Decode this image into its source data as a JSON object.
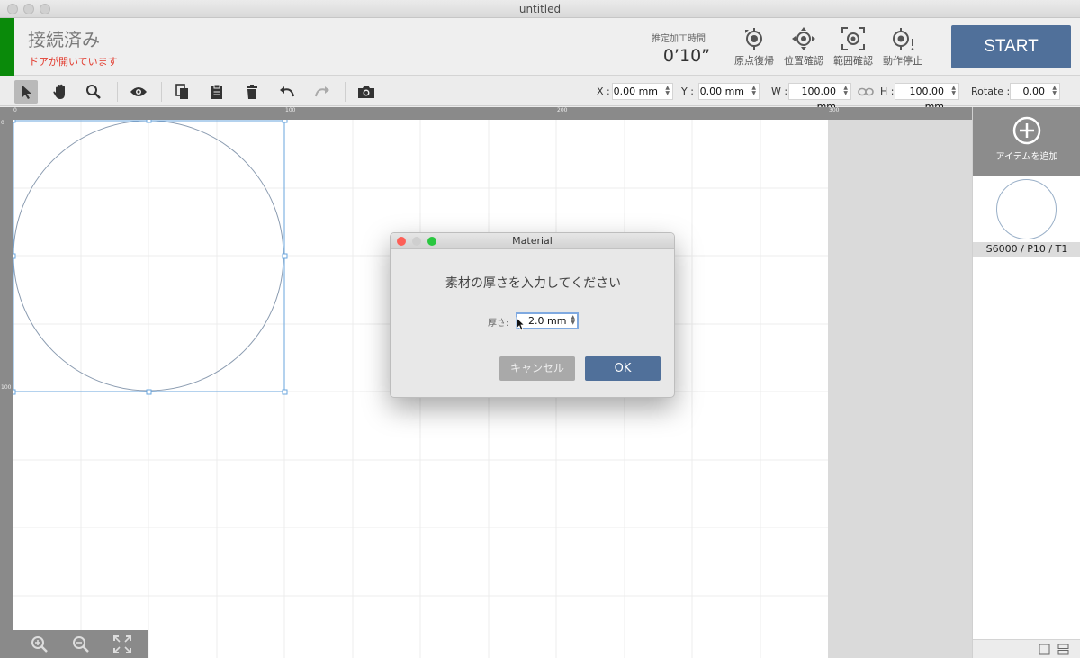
{
  "window": {
    "title": "untitled"
  },
  "header": {
    "connection_status": "接続済み",
    "door_status": "ドアが開いています",
    "time_label": "推定加工時間",
    "time_value": "0’10”",
    "buttons": [
      {
        "label": "原点復帰",
        "icon": "origin-icon"
      },
      {
        "label": "位置確認",
        "icon": "position-check-icon"
      },
      {
        "label": "範囲確認",
        "icon": "range-check-icon"
      },
      {
        "label": "動作停止",
        "icon": "stop-icon"
      }
    ],
    "start_label": "START"
  },
  "toolbar": {
    "x_label": "X :",
    "x_value": "0.00 mm",
    "y_label": "Y :",
    "y_value": "0.00 mm",
    "w_label": "W :",
    "w_value": "100.00 mm",
    "h_label": "H :",
    "h_value": "100.00 mm",
    "rotate_label": "Rotate :",
    "rotate_value": "0.00"
  },
  "ruler": {
    "top_labels": [
      "0",
      "100",
      "200",
      "300"
    ],
    "left_labels": [
      "0",
      "100"
    ]
  },
  "right_panel": {
    "add_item_label": "アイテムを追加",
    "item_label": "S6000 / P10 / T1"
  },
  "dialog": {
    "title": "Material",
    "message": "素材の厚さを入力してください",
    "thickness_label": "厚さ:",
    "thickness_value": "2.0 mm",
    "cancel_label": "キャンセル",
    "ok_label": "OK"
  },
  "colors": {
    "accent": "#50709a",
    "connected": "#0a8a0a",
    "warning": "#e23b2e"
  }
}
